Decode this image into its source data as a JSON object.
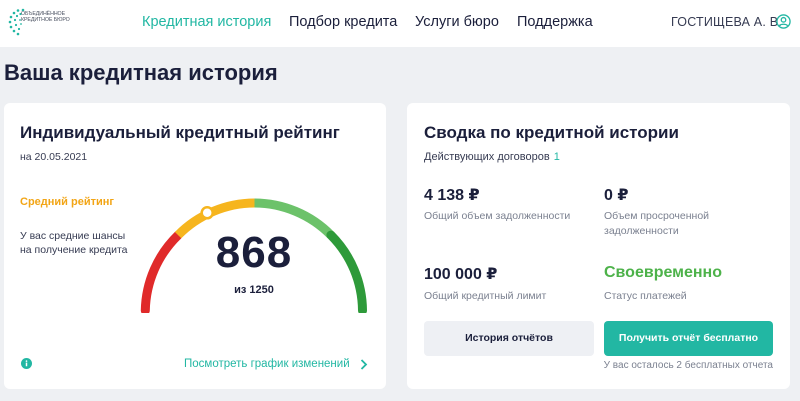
{
  "colors": {
    "accent": "#22b7a3",
    "rating_orange": "#f2a516",
    "on_time_green": "#4db24a",
    "gauge_red": "#e02a2a",
    "gauge_yellow": "#f6b51e",
    "gauge_light_green": "#6cc26a",
    "gauge_dark_green": "#2e9a3a"
  },
  "header": {
    "logo_text": "Объединённое кредитное бюро",
    "nav": [
      {
        "label": "Кредитная история",
        "active": true
      },
      {
        "label": "Подбор кредита",
        "active": false
      },
      {
        "label": "Услуги бюро",
        "active": false
      },
      {
        "label": "Поддержка",
        "active": false
      }
    ],
    "user_name": "ГОСТИЩЕВА А. В.",
    "user_icon": "user-circle-icon"
  },
  "page_title": "Ваша кредитная история",
  "rating_card": {
    "title": "Индивидуальный кредитный рейтинг",
    "date": "на 20.05.2021",
    "rating_label": "Средний рейтинг",
    "rating_description": "У вас средние шансы на получение кредита",
    "score": "868",
    "score_of": "из 1250",
    "score_value": 868,
    "score_max": 1250,
    "info_icon": "info-icon",
    "history_link": "Посмотреть график изменений",
    "chevron_icon": "chevron-right-icon"
  },
  "summary_card": {
    "title": "Сводка по кредитной истории",
    "contracts_label": "Действующих договоров",
    "contracts_count": "1",
    "total_debt_value": "4 138 ₽",
    "total_debt_label": "Общий объем задолженности",
    "overdue_value": "0 ₽",
    "overdue_label": "Объем просроченной задолженности",
    "credit_limit_value": "100 000 ₽",
    "credit_limit_label": "Общий кредитный лимит",
    "payment_status_value": "Своевременно",
    "payment_status_label": "Статус платежей",
    "history_button": "История отчётов",
    "free_report_button": "Получить отчёт бесплатно",
    "remaining_text": "У вас осталось 2 бесплатных отчета"
  }
}
